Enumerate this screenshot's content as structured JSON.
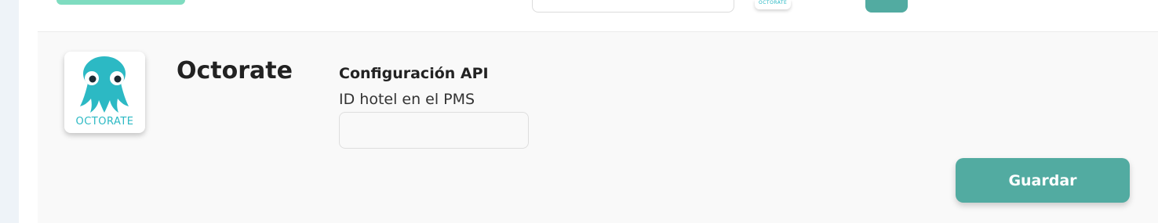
{
  "colors": {
    "accent": "#52aba1",
    "brand_logo": "#2cb9c4",
    "top_highlight": "#7fdcc0",
    "card_background": "#f9f9f9"
  },
  "top_strip": {
    "logo_thumb_text": "OCTORATE"
  },
  "provider": {
    "name": "Octorate",
    "logo_text": "OCTORATE",
    "logo_icon": "octopus-logo-icon"
  },
  "api_config": {
    "heading": "Configuración API",
    "hotel_id_label": "ID hotel en el PMS",
    "hotel_id_value": "",
    "hotel_id_placeholder": ""
  },
  "actions": {
    "save_label": "Guardar"
  }
}
